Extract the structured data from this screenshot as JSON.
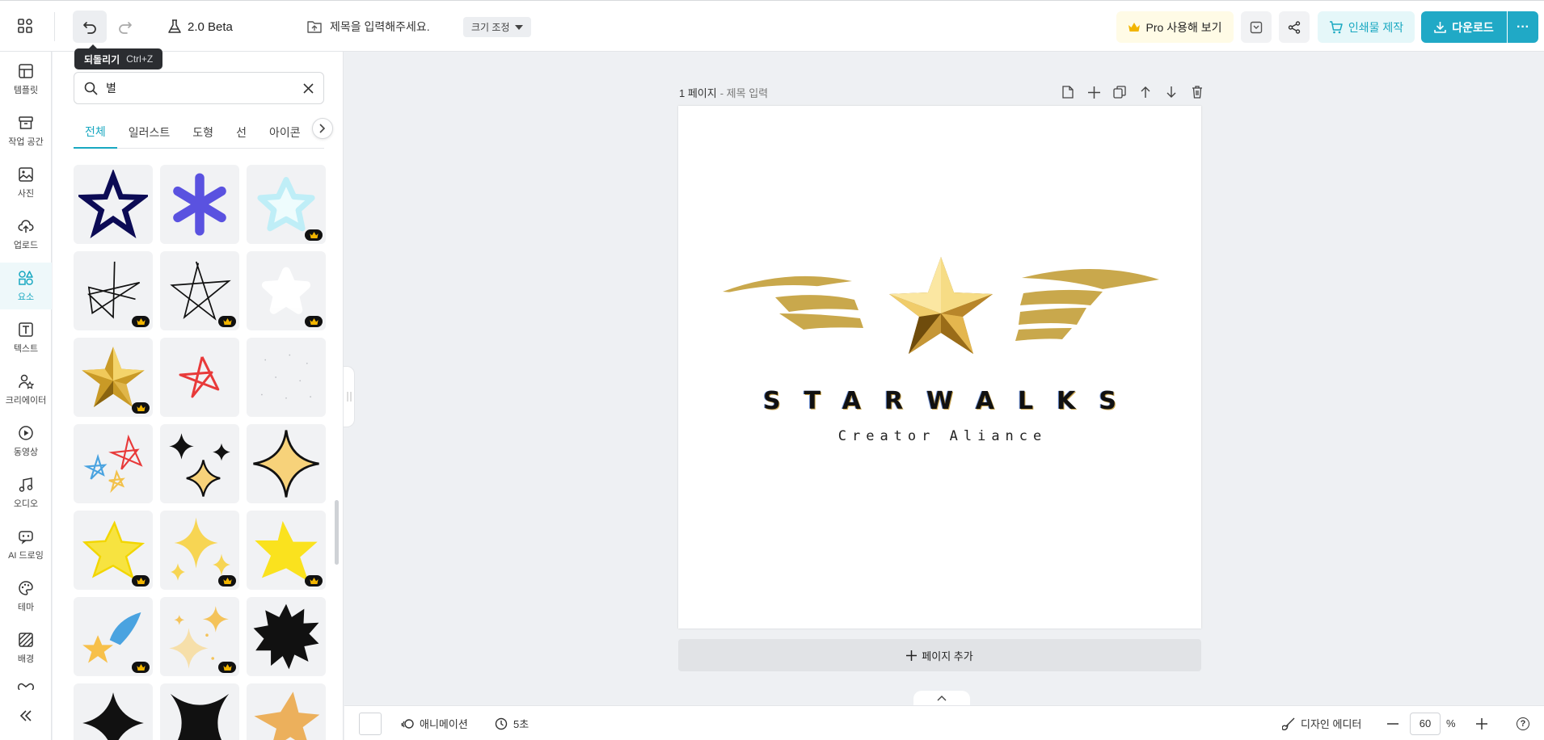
{
  "topbar": {
    "version_label": "2.0 Beta",
    "title_placeholder": "제목을 입력해주세요.",
    "resize_label": "크기 조정",
    "pro_label": "Pro 사용해 보기",
    "print_label": "인쇄물 제작",
    "download_label": "다운로드",
    "more_label": "···"
  },
  "tooltip": {
    "label": "되돌리기",
    "shortcut": "Ctrl+Z"
  },
  "sidebar": {
    "items": [
      {
        "label": "템플릿",
        "icon": "template-icon"
      },
      {
        "label": "작업 공간",
        "icon": "workspace-icon"
      },
      {
        "label": "사진",
        "icon": "photo-icon"
      },
      {
        "label": "업로드",
        "icon": "upload-icon"
      },
      {
        "label": "요소",
        "icon": "elements-icon",
        "active": true
      },
      {
        "label": "텍스트",
        "icon": "text-icon"
      },
      {
        "label": "크리에이터",
        "icon": "creator-icon"
      },
      {
        "label": "동영상",
        "icon": "video-icon"
      },
      {
        "label": "오디오",
        "icon": "audio-icon"
      },
      {
        "label": "AI 드로잉",
        "icon": "ai-drawing-icon"
      },
      {
        "label": "테마",
        "icon": "theme-icon"
      },
      {
        "label": "배경",
        "icon": "background-icon"
      }
    ]
  },
  "panel": {
    "search_value": "별",
    "tabs": [
      "전체",
      "일러스트",
      "도형",
      "선",
      "아이콘"
    ],
    "active_tab": "전체"
  },
  "canvas": {
    "page_number": "1 페이지",
    "page_title": "- 제목 입력",
    "brand_name": "STARWALKS",
    "brand_sub": "Creator Aliance",
    "add_page_label": "페이지 추가"
  },
  "bottombar": {
    "animation_label": "애니메이션",
    "duration_label": "5초",
    "design_editor_label": "디자인 에디터",
    "zoom_value": "60",
    "zoom_unit": "%",
    "help_label": "?"
  },
  "colors": {
    "accent": "#20a9c6",
    "pro_bg": "#fffbe6",
    "gold": "#c9a84c"
  }
}
